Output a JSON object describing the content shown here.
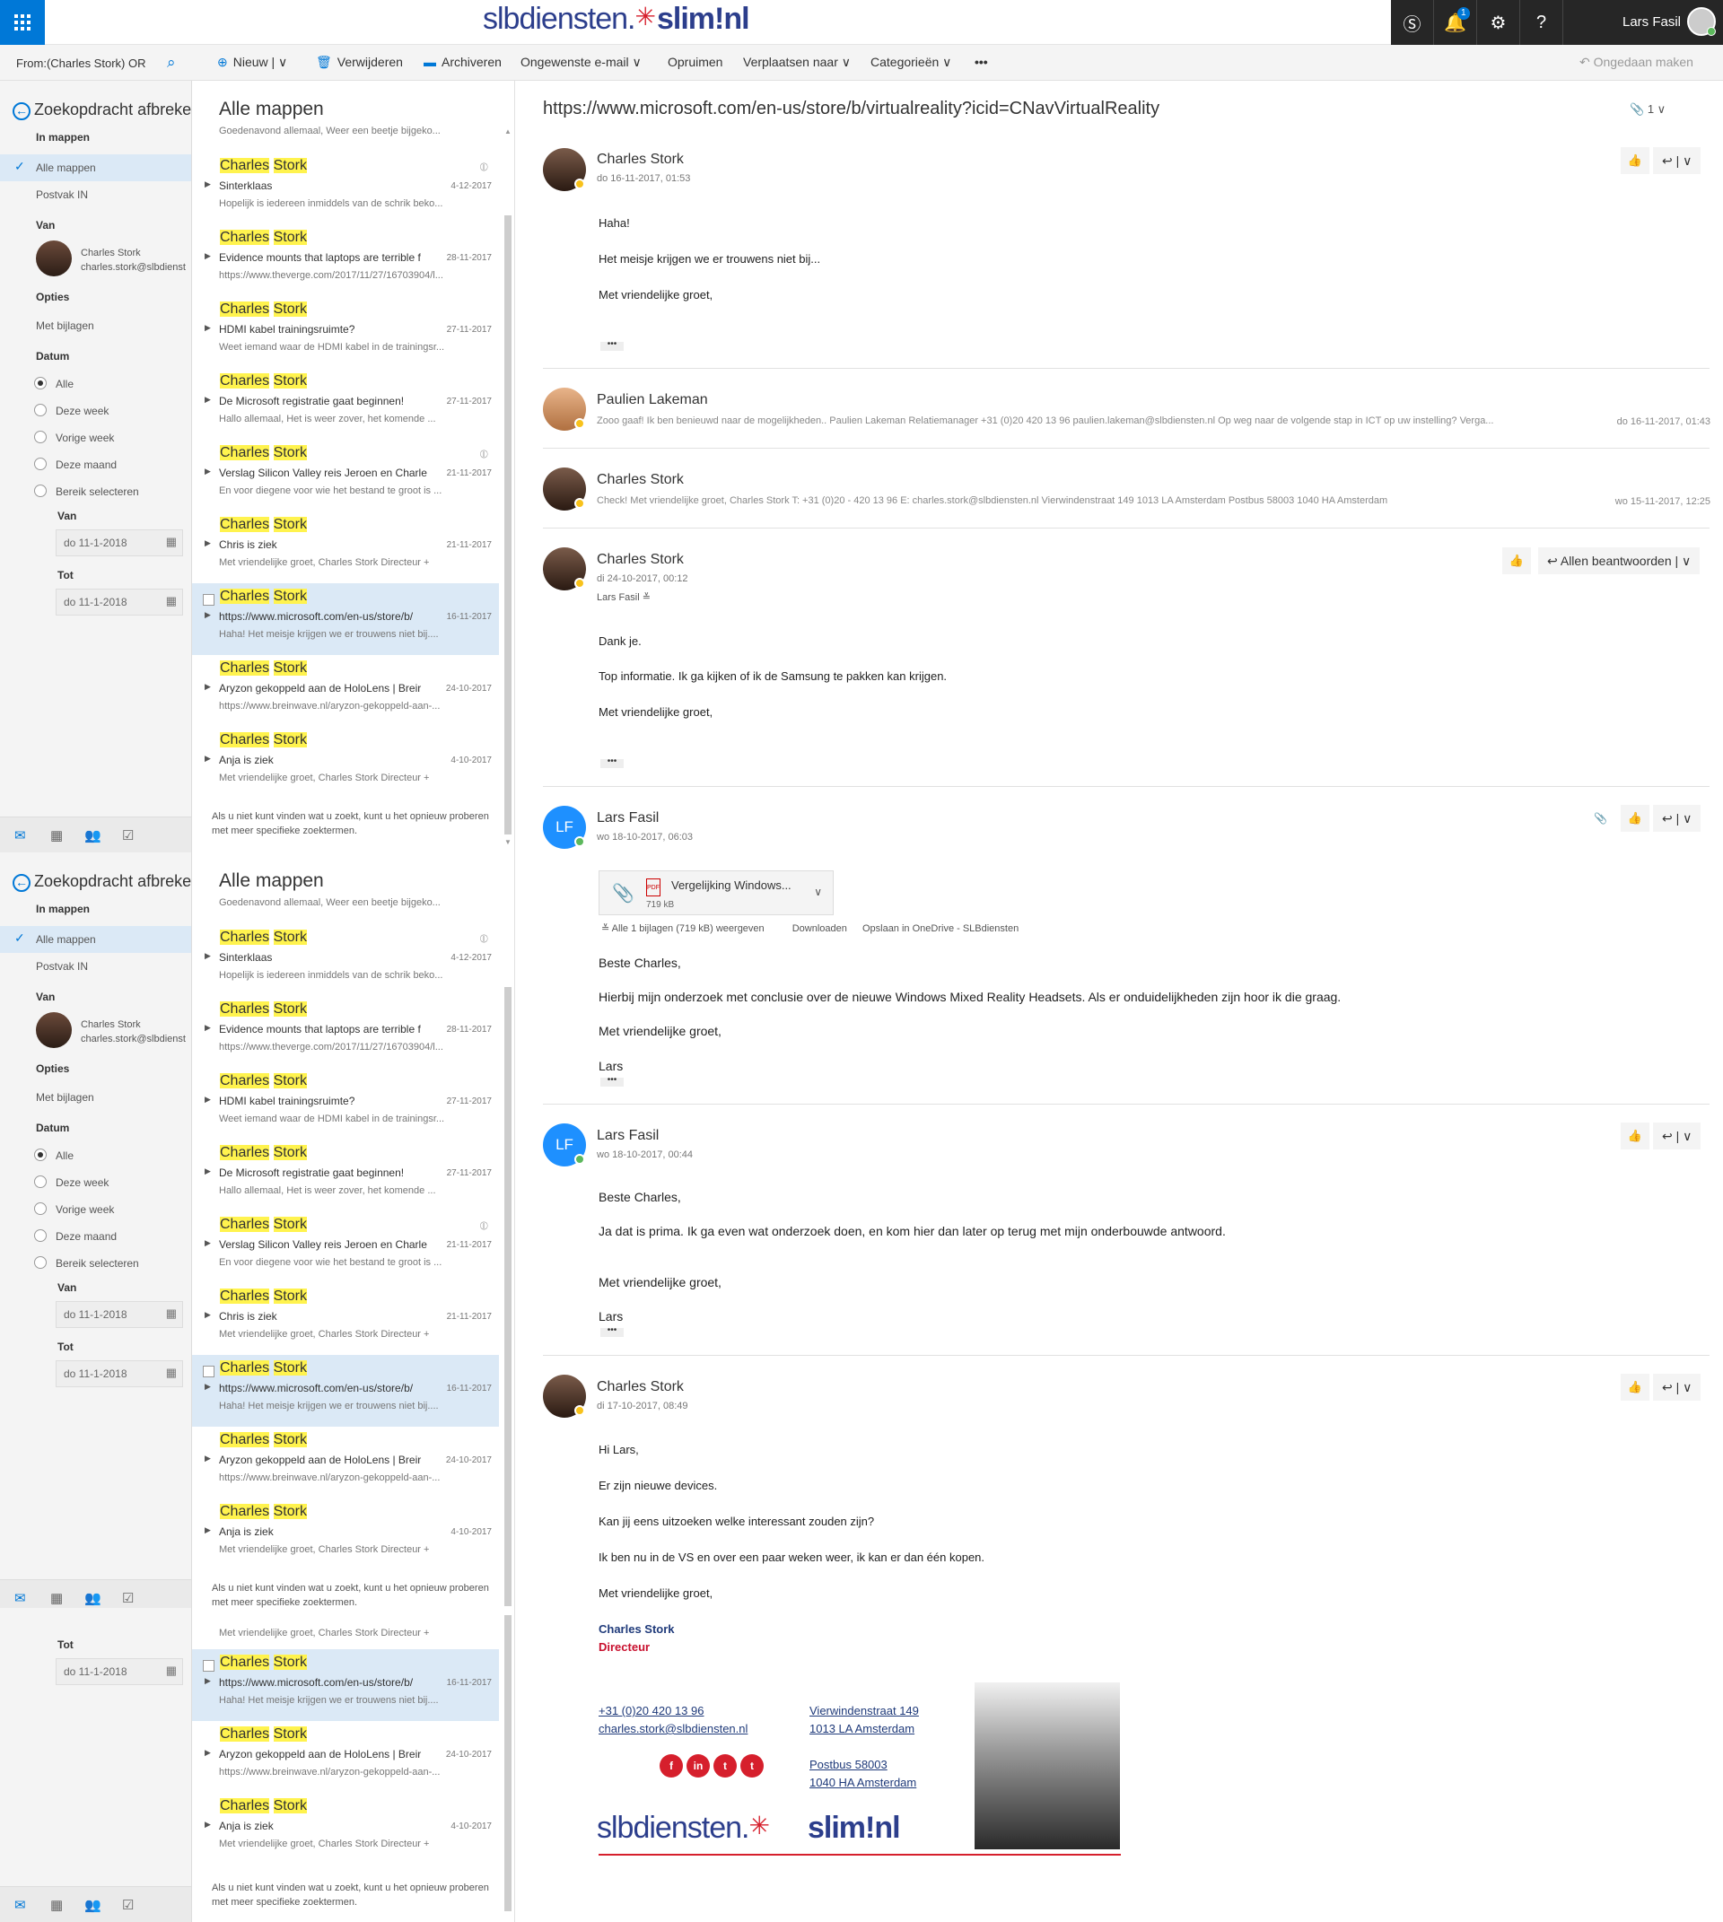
{
  "topbar": {
    "brand_slb": "slbdiensten.",
    "brand_slim": "slim!nl",
    "notification_count": "1",
    "user_name": "Lars Fasil"
  },
  "commandbar": {
    "search_text": "From:(Charles Stork) OR",
    "new": "Nieuw",
    "delete": "Verwijderen",
    "archive": "Archiveren",
    "junk": "Ongewenste e-mail",
    "cleanup": "Opruimen",
    "move": "Verplaatsen naar",
    "categories": "Categorieën",
    "more": "•••",
    "undo": "Ongedaan maken"
  },
  "leftnav": {
    "back": "Zoekopdracht afbreken",
    "in_folders": "In mappen",
    "all_folders": "Alle mappen",
    "inbox": "Postvak IN",
    "from_label": "Van",
    "person_name": "Charles Stork",
    "person_email": "charles.stork@slbdienst",
    "options": "Opties",
    "with_attachments": "Met bijlagen",
    "date_label": "Datum",
    "radio_all": "Alle",
    "radio_week": "Deze week",
    "radio_prev_week": "Vorige week",
    "radio_month": "Deze maand",
    "radio_range": "Bereik selecteren",
    "from_date_label": "Van",
    "from_date": "do 11-1-2018",
    "to_date_label": "Tot",
    "to_date": "do 11-1-2018"
  },
  "msglist": {
    "title": "Alle mappen",
    "subtitle": "Goedenavond allemaal,   Weer een beetje bijgeko...",
    "items": [
      {
        "first": "Charles",
        "last": "Stork",
        "subject": "Sinterklaas",
        "preview": "Hopelijk is iedereen inmiddels van de schrik beko...",
        "date": "4-12-2017",
        "clip": true
      },
      {
        "first": "Charles",
        "last": "Stork",
        "subject": "Evidence mounts that laptops are terrible f",
        "preview": "https://www.theverge.com/2017/11/27/16703904/l...",
        "date": "28-11-2017",
        "clip": false
      },
      {
        "first": "Charles",
        "last": "Stork",
        "subject": "HDMI kabel trainingsruimte?",
        "preview": "Weet iemand waar de HDMI kabel in de trainingsr...",
        "date": "27-11-2017",
        "clip": false
      },
      {
        "first": "Charles",
        "last": "Stork",
        "subject": "De Microsoft registratie gaat beginnen!",
        "preview": "Hallo allemaal,   Het is weer zover, het komende ...",
        "date": "27-11-2017",
        "clip": false
      },
      {
        "first": "Charles",
        "last": "Stork",
        "subject": "Verslag Silicon Valley reis Jeroen en Charle",
        "preview": "En voor diegene voor wie het bestand te groot is ...",
        "date": "21-11-2017",
        "clip": true
      },
      {
        "first": "Charles",
        "last": "Stork",
        "subject": "Chris is ziek",
        "preview": "Met vriendelijke groet,   Charles Stork  Directeur   +",
        "date": "21-11-2017",
        "clip": false
      },
      {
        "first": "Charles",
        "last": "Stork",
        "subject": "https://www.microsoft.com/en-us/store/b/",
        "preview": "Haha!   Het meisje krijgen we er trouwens niet bij....",
        "date": "16-11-2017",
        "clip": false,
        "selected": true
      },
      {
        "first": "Charles",
        "last": "Stork",
        "subject": "Aryzon gekoppeld aan de HoloLens | Breir",
        "preview": "https://www.breinwave.nl/aryzon-gekoppeld-aan-...",
        "date": "24-10-2017",
        "clip": false
      },
      {
        "first": "Charles",
        "last": "Stork",
        "subject": "Anja is ziek",
        "preview": "Met vriendelijke groet,   Charles Stork  Directeur   +",
        "date": "4-10-2017",
        "clip": false
      }
    ],
    "help": "Als u niet kunt vinden wat u zoekt, kunt u het opnieuw proberen met meer specifieke zoektermen.",
    "dup_preview": "Met vriendelijke groet,   Charles Stork  Directeur   +"
  },
  "reading": {
    "subject": "https://www.microsoft.com/en-us/store/b/virtualreality?icid=CNavVirtualReality",
    "attach_count": "1",
    "m1": {
      "from": "Charles Stork",
      "date": "do 16-11-2017, 01:53",
      "l1": "Haha!",
      "l2": "Het meisje krijgen we er trouwens niet bij...",
      "l3": "Met vriendelijke groet,"
    },
    "m2": {
      "from": "Paulien Lakeman",
      "snippet": "Zooo gaaf! Ik ben benieuwd naar de mogelijkheden.. Paulien Lakeman Relatiemanager +31 (0)20 420 13 96 paulien.lakeman@slbdiensten.nl Op weg naar de volgende stap in ICT op uw instelling? Verga...",
      "date": "do 16-11-2017, 01:43"
    },
    "m3": {
      "from": "Charles Stork",
      "snippet": "Check! Met vriendelijke groet, Charles Stork T: +31 (0)20 - 420 13 96 E: charles.stork@slbdiensten.nl Vierwindenstraat 149 1013 LA Amsterdam Postbus 58003 1040 HA Amsterdam",
      "date": "wo 15-11-2017, 12:25"
    },
    "m4": {
      "from": "Charles Stork",
      "date": "di 24-10-2017, 00:12",
      "to": "Lars Fasil",
      "reply_all": "Allen beantwoorden",
      "l1": "Dank je.",
      "l2": "Top informatie. Ik ga kijken of ik de Samsung te pakken kan krijgen.",
      "l3": "Met vriendelijke groet,"
    },
    "m5": {
      "from": "Lars Fasil",
      "initials": "LF",
      "date": "wo 18-10-2017, 06:03",
      "attach_name": "Vergelijking Windows...",
      "attach_size": "719 kB",
      "attach_all": "Alle 1 bijlagen (719 kB) weergeven",
      "download": "Downloaden",
      "save": "Opslaan in OneDrive - SLBdiensten",
      "l1": "Beste Charles,",
      "l2": "Hierbij mijn onderzoek met conclusie over de nieuwe Windows Mixed Reality Headsets. Als er onduidelijkheden zijn hoor ik die graag.",
      "l3": "Met vriendelijke groet,",
      "l4": "Lars"
    },
    "m6": {
      "from": "Lars Fasil",
      "initials": "LF",
      "date": "wo 18-10-2017, 00:44",
      "l1": "Beste Charles,",
      "l2": "Ja dat is prima. Ik ga even wat onderzoek doen, en kom hier dan later op terug met mijn onderbouwde antwoord.",
      "l3": "Met vriendelijke groet,",
      "l4": "Lars"
    },
    "m7": {
      "from": "Charles Stork",
      "date": "di 17-10-2017, 08:49",
      "l1": "Hi Lars,",
      "l2": "Er zijn nieuwe devices.",
      "l3": "Kan jij eens uitzoeken welke interessant zouden zijn?",
      "l4": "Ik ben nu in de VS en over een paar weken weer, ik kan er dan één kopen.",
      "l5": "Met vriendelijke groet,",
      "sig_name": "Charles Stork",
      "sig_title": "Directeur",
      "phone": "+31 (0)20 420 13 96",
      "email": "charles.stork@slbdiensten.nl",
      "street": "Vierwindenstraat 149",
      "city": "1013 LA Amsterdam",
      "pobox": "Postbus 58003",
      "pocity": "1040 HA Amsterdam",
      "logo_slb": "slbdiensten.",
      "logo_slim": "slim!nl"
    },
    "more": "•••"
  },
  "colors": {
    "accent": "#0078d7",
    "highlight": "#fff34e",
    "selected": "#dbe9f6",
    "brand_red": "#d61f2c",
    "brand_blue": "#2c3e8c"
  }
}
